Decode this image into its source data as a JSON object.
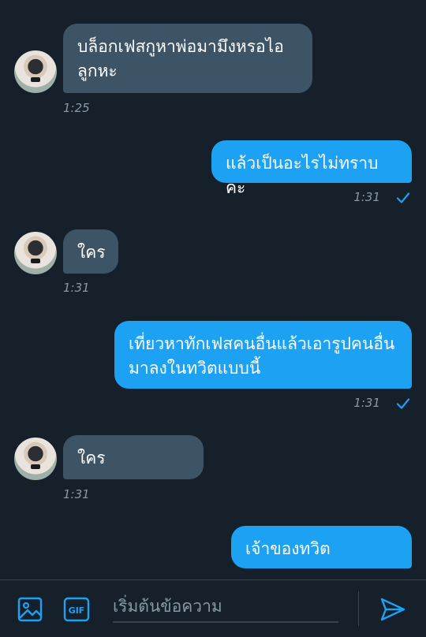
{
  "messages": [
    {
      "direction": "in",
      "text": "บล็อกเฟสกูหาพ่อมามึงหรอไอลูกหะ",
      "time": "1:25"
    },
    {
      "direction": "out",
      "text": "แล้วเป็นอะไรไม่ทราบคะ",
      "time": "1:31"
    },
    {
      "direction": "in",
      "text": "ใคร",
      "time": "1:31"
    },
    {
      "direction": "out",
      "text": "เที่ยวหาทักเฟสคนอื่นแล้วเอารูปคนอื่นมาลงในทวิตแบบนี้",
      "time": "1:31"
    },
    {
      "direction": "in",
      "text": "ใคร",
      "time": "1:31"
    },
    {
      "direction": "out",
      "text": "เจ้าของทวิต",
      "time": ""
    }
  ],
  "composer": {
    "placeholder": "เริ่มต้นข้อความ",
    "gif_label": "GIF"
  },
  "icons": {
    "image": "image-icon",
    "gif": "gif-icon",
    "send": "send-icon",
    "read_receipt": "checkmark-icon"
  },
  "colors": {
    "background": "#15202b",
    "incoming_bubble": "#3d5466",
    "outgoing_bubble": "#1da1f2",
    "accent": "#1da1f2",
    "muted_text": "#8899a6"
  }
}
